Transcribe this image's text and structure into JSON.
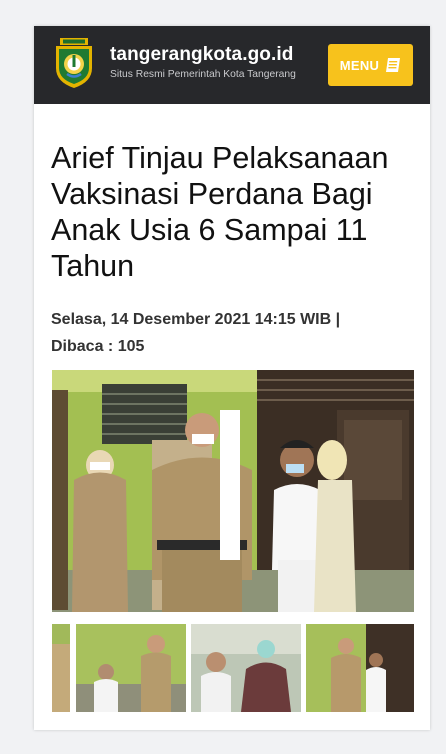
{
  "header": {
    "site_name": "tangerangkota.go.id",
    "tagline": "Situs Resmi Pemerintah Kota Tangerang",
    "menu_label": "MENU",
    "logo_icon": "tangerang-seal-icon",
    "menu_icon": "document-lines-icon",
    "colors": {
      "header_bg": "#27282b",
      "menu_bg": "#f7c21c"
    }
  },
  "article": {
    "title": "Arief Tinjau Pelaksanaan Vaksinasi Perdana Bagi Anak Usia 6 Sampai 11 Tahun",
    "meta_line1": "Selasa, 14 Desember 2021 14:15 WIB |",
    "meta_line2": "Dibaca : 105"
  },
  "gallery": {
    "thumbnail_count": 4,
    "active_thumbnail": 4
  }
}
